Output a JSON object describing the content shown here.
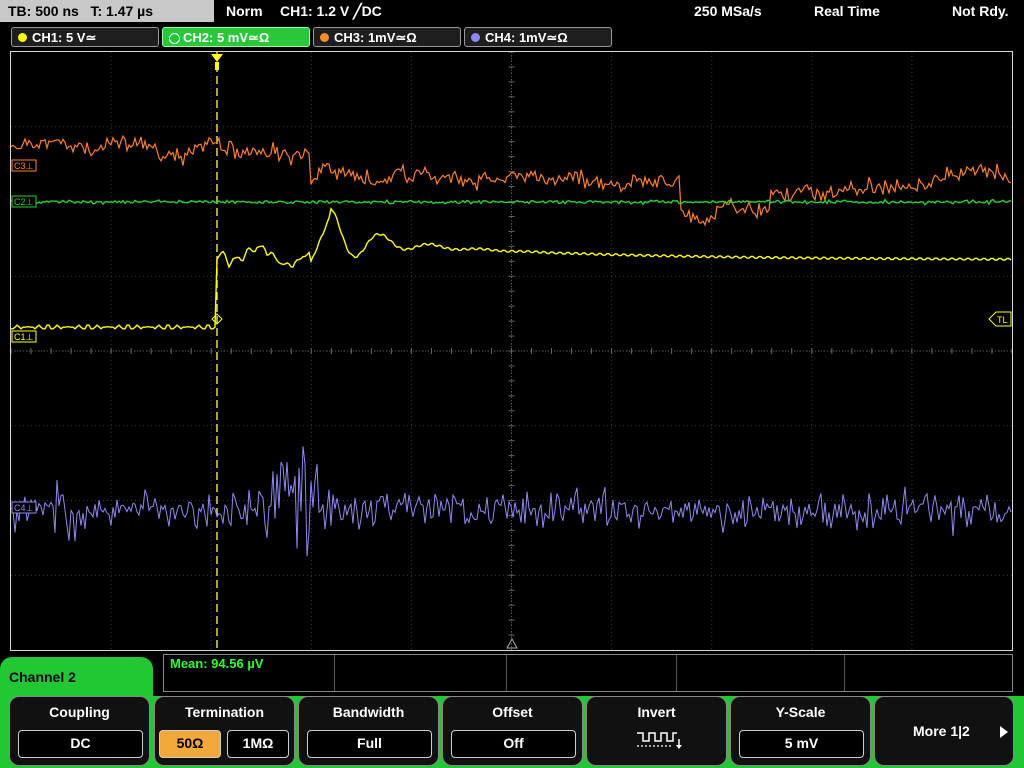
{
  "status": {
    "timebase": "TB: 500 ns",
    "trigger_time": "T: 1.47 µs",
    "mode": "Norm",
    "trigger_info": "CH1: 1.2 V ╱DC",
    "sample_rate": "250 MSa/s",
    "acq_mode": "Real Time",
    "state": "Not Rdy."
  },
  "channels": [
    {
      "label": "CH1: 5 V≃",
      "color": "#ffff00",
      "short": "C1⊥"
    },
    {
      "label": "CH2: 5 mV≃Ω",
      "color": "#22c834",
      "short": "C2⊥"
    },
    {
      "label": "CH3: 1mV≃Ω",
      "color": "#ff8a2a",
      "short": "C3⊥"
    },
    {
      "label": "CH4: 1mV≃Ω",
      "color": "#8d89f0",
      "short": "C4⊥"
    }
  ],
  "trigger_level_label": "TL",
  "measurement": {
    "mean": "Mean: 94.56 µV"
  },
  "menu": {
    "title": "Channel 2",
    "coupling": {
      "title": "Coupling",
      "value": "DC"
    },
    "termination": {
      "title": "Termination",
      "option1": "50Ω",
      "option2": "1MΩ",
      "selected": "50Ω"
    },
    "bandwidth": {
      "title": "Bandwidth",
      "value": "Full"
    },
    "offset": {
      "title": "Offset",
      "value": "Off"
    },
    "invert": {
      "title": "Invert",
      "icon": "invert-waveform-icon"
    },
    "yscale": {
      "title": "Y-Scale",
      "value": "5 mV"
    },
    "more": {
      "label": "More 1|2",
      "icon": "triangle-right-icon"
    }
  }
}
